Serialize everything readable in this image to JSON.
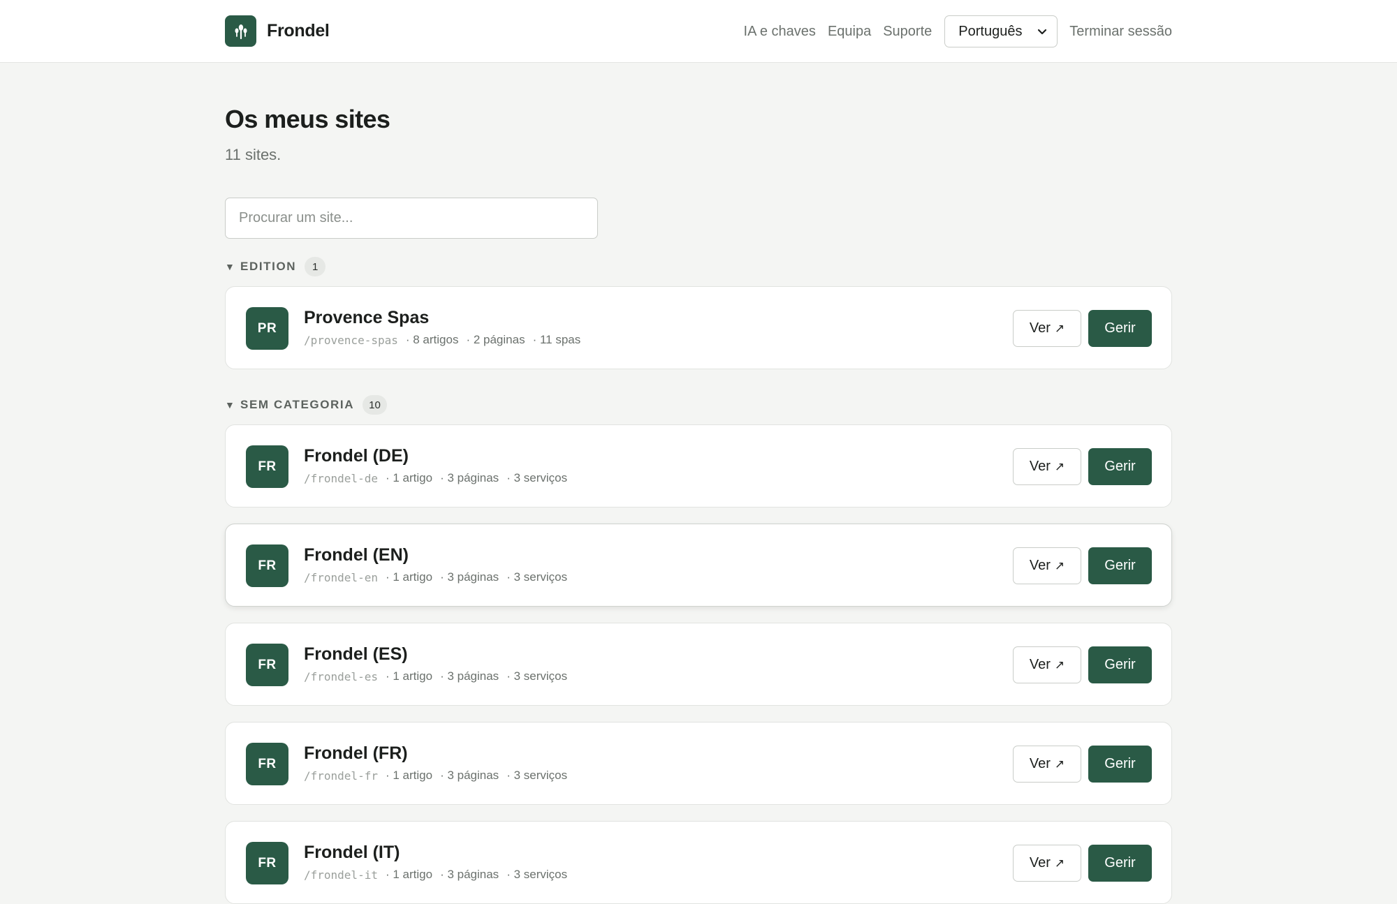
{
  "app": {
    "brand": "Frondel",
    "accent": "#2a5a46"
  },
  "nav": {
    "links": [
      "IA e chaves",
      "Equipa",
      "Suporte"
    ],
    "language": "Português",
    "logout": "Terminar sessão"
  },
  "page": {
    "title": "Os meus sites",
    "subtitle": "11 sites."
  },
  "search": {
    "placeholder": "Procurar um site...",
    "value": ""
  },
  "groups": [
    {
      "name": "EDITION",
      "count": "1",
      "sites": [
        {
          "initials": "PR",
          "name": "Provence Spas",
          "slug": "/provence-spas",
          "stats": [
            "· 8 artigos",
            "· 2 páginas",
            "· 11 spas"
          ],
          "view": "Ver",
          "manage": "Gerir"
        }
      ]
    },
    {
      "name": "SEM CATEGORIA",
      "count": "10",
      "sites": [
        {
          "initials": "FR",
          "name": "Frondel (DE)",
          "slug": "/frondel-de",
          "stats": [
            "· 1 artigo",
            "· 3 páginas",
            "· 3 serviços"
          ],
          "view": "Ver",
          "manage": "Gerir"
        },
        {
          "initials": "FR",
          "name": "Frondel (EN)",
          "slug": "/frondel-en",
          "stats": [
            "· 1 artigo",
            "· 3 páginas",
            "· 3 serviços"
          ],
          "view": "Ver",
          "manage": "Gerir"
        },
        {
          "initials": "FR",
          "name": "Frondel (ES)",
          "slug": "/frondel-es",
          "stats": [
            "· 1 artigo",
            "· 3 páginas",
            "· 3 serviços"
          ],
          "view": "Ver",
          "manage": "Gerir"
        },
        {
          "initials": "FR",
          "name": "Frondel (FR)",
          "slug": "/frondel-fr",
          "stats": [
            "· 1 artigo",
            "· 3 páginas",
            "· 3 serviços"
          ],
          "view": "Ver",
          "manage": "Gerir"
        },
        {
          "initials": "FR",
          "name": "Frondel (IT)",
          "slug": "/frondel-it",
          "stats": [
            "· 1 artigo",
            "· 3 páginas",
            "· 3 serviços"
          ],
          "view": "Ver",
          "manage": "Gerir"
        }
      ]
    }
  ]
}
